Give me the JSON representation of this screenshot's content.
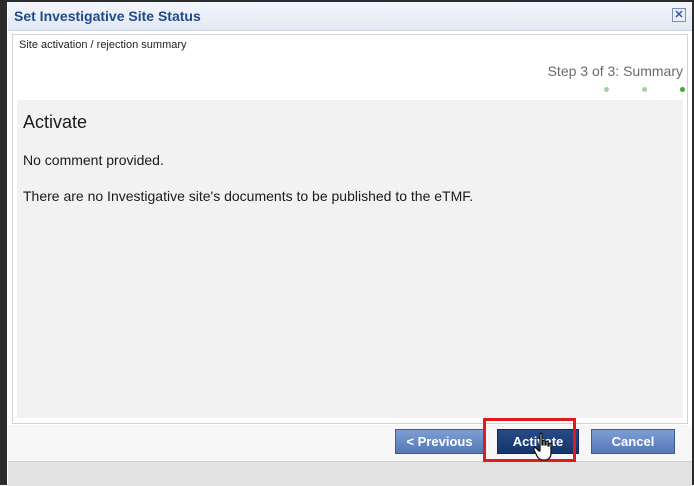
{
  "dialog": {
    "title": "Set Investigative Site Status",
    "close_glyph": "✕"
  },
  "summary": {
    "subtitle": "Site activation / rejection summary",
    "step_label": "Step 3 of 3: Summary",
    "steps": [
      {
        "state": "inactive",
        "color": "#9fd49f"
      },
      {
        "state": "inactive",
        "color": "#9fd49f"
      },
      {
        "state": "active",
        "color": "#3aa83a"
      }
    ]
  },
  "content": {
    "heading": "Activate",
    "comment": "No comment provided.",
    "documents_note": "There are no Investigative site's documents to be published to the eTMF."
  },
  "buttons": {
    "previous": "< Previous",
    "activate": "Activate",
    "cancel": "Cancel"
  },
  "colors": {
    "title": "#1f4a8a",
    "primary_button": "#16356c",
    "secondary_button": "#5377b9",
    "highlight": "#e01b1b"
  },
  "icons": {
    "close": "close-icon",
    "cursor": "hand-pointer-icon"
  }
}
